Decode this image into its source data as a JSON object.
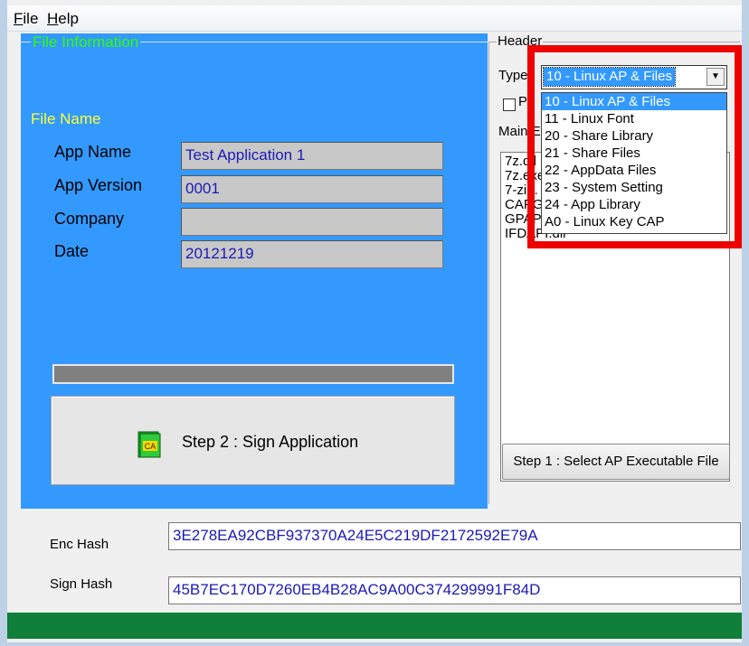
{
  "menu": {
    "file": {
      "accel": "F",
      "rest": "ile"
    },
    "help": {
      "accel": "H",
      "rest": "elp"
    }
  },
  "file_info": {
    "group_title": "File Information",
    "section_title": "File Name",
    "fields": [
      {
        "label": "App Name",
        "value": "Test Application 1"
      },
      {
        "label": "App Version",
        "value": "0001"
      },
      {
        "label": "Company",
        "value": ""
      },
      {
        "label": "Date",
        "value": "20121219"
      }
    ],
    "progress_percent": 100,
    "sign_button_label": "Step 2 : Sign Application",
    "sign_icon_text": "CA"
  },
  "header": {
    "group_title": "Header",
    "type_label": "Type",
    "type_selected": "10 - Linux AP & Files",
    "type_options": [
      "10 - Linux AP & Files",
      "11 - Linux Font",
      "20 - Share Library",
      "21 - Share Files",
      "22 - AppData Files",
      "23 - System Setting",
      "24 - App Library",
      "A0 - Linux Key CAP"
    ],
    "checkbox_label": "Pe",
    "main_label": "Main E",
    "files": [
      "7z.dll",
      "7z.exe",
      "7-zip.",
      "CAPG",
      "GPAPI.dll",
      "IFDAPI.dll"
    ],
    "select_button_label": "Step 1 : Select AP Executable File"
  },
  "hashes": {
    "enc_label": "Enc Hash",
    "enc_value": "3E278EA92CBF937370A24E5C219DF2172592E79A",
    "sign_label": "Sign Hash",
    "sign_value": "45B7EC170D7260EB4B28AC9A00C374299991F84D"
  },
  "colors": {
    "panel": "#3399ff",
    "group_title": "#33ff00",
    "section_title": "#ffff33",
    "highlight": "#ee0000",
    "status": "#0f7f3a"
  }
}
